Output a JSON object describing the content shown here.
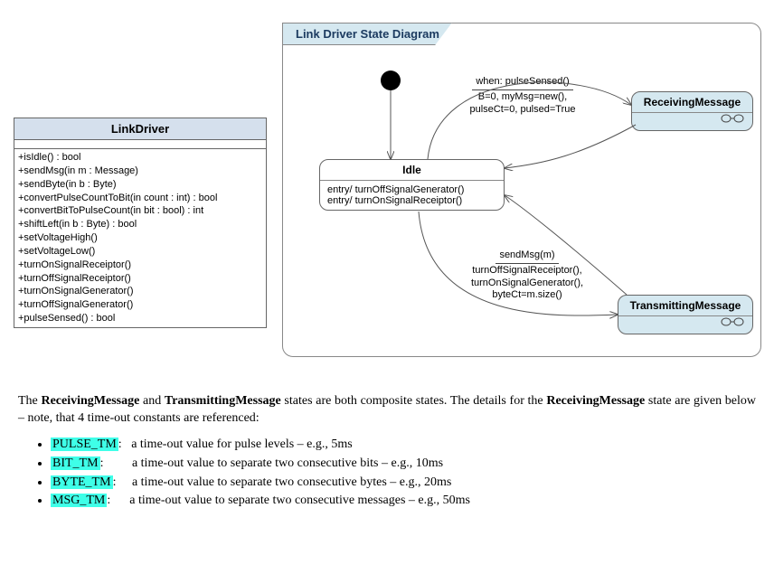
{
  "class": {
    "title": "LinkDriver",
    "ops": [
      "+isIdle() : bool",
      "+sendMsg(in m : Message)",
      "+sendByte(in b : Byte)",
      "+convertPulseCountToBit(in count : int) : bool",
      "+convertBitToPulseCount(in bit : bool) : int",
      "+shiftLeft(in b : Byte) : bool",
      "+setVoltageHigh()",
      "+setVoltageLow()",
      "+turnOnSignalReceiptor()",
      "+turnOffSignalReceiptor()",
      "+turnOnSignalGenerator()",
      "+turnOffSignalGenerator()",
      "+pulseSensed() : bool"
    ]
  },
  "diagram": {
    "title": "Link Driver State Diagram",
    "states": {
      "idle": {
        "name": "Idle",
        "entry1": "entry/ turnOffSignalGenerator()",
        "entry2": "entry/ turnOnSignalReceiptor()"
      },
      "receiving": {
        "name": "ReceivingMessage"
      },
      "transmitting": {
        "name": "TransmittingMessage"
      }
    },
    "transitions": {
      "toReceiving": {
        "trigger": "when: pulseSensed()",
        "action": "B=0, myMsg=new(),\npulseCt=0, pulsed=True"
      },
      "toTransmitting": {
        "trigger": "sendMsg(m)",
        "action": "turnOffSignalReceiptor(),\nturnOnSignalGenerator(),\nbyteCt=m.size()"
      }
    }
  },
  "description": {
    "p1_a": "The ",
    "p1_b": " and ",
    "p1_c": " states are both composite states. The details for the ",
    "p1_d": " state are given below – note, that 4 time-out constants are referenced:",
    "rm": "ReceivingMessage",
    "tm": "TransmittingMessage",
    "items": [
      {
        "name": "PULSE_TM",
        "desc": "a time-out value for pulse levels – e.g., 5ms"
      },
      {
        "name": "BIT_TM",
        "desc": "a time-out value to separate two consecutive bits – e.g., 10ms"
      },
      {
        "name": "BYTE_TM",
        "desc": "a time-out value to separate two consecutive bytes – e.g., 20ms"
      },
      {
        "name": "MSG_TM",
        "desc": "a time-out value to separate two consecutive messages – e.g., 50ms"
      }
    ]
  }
}
